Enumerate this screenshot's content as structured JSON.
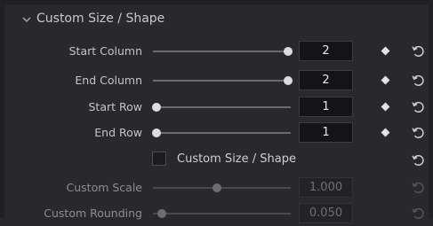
{
  "section": {
    "title": "Custom Size / Shape"
  },
  "rows": [
    {
      "label": "Start Column",
      "value": "2",
      "slider_fraction": 0.98
    },
    {
      "label": "End Column",
      "value": "2",
      "slider_fraction": 0.98
    },
    {
      "label": "Start Row",
      "value": "1",
      "slider_fraction": 0.03
    },
    {
      "label": "End Row",
      "value": "1",
      "slider_fraction": 0.03
    }
  ],
  "checkbox": {
    "label": "Custom Size / Shape",
    "checked": false
  },
  "disabled_rows": [
    {
      "label": "Custom Scale",
      "value": "1.000",
      "slider_fraction": 0.45
    },
    {
      "label": "Custom Rounding",
      "value": "0.050",
      "slider_fraction": 0.05
    }
  ],
  "icons": {
    "collapse": "chevron-down-icon",
    "keyframe": "keyframe-diamond-icon",
    "reset": "reset-icon"
  },
  "colors": {
    "background": "#29292c",
    "text": "#c4c4c7",
    "disabled_text": "#8d8d90",
    "field_bg": "#141416"
  }
}
